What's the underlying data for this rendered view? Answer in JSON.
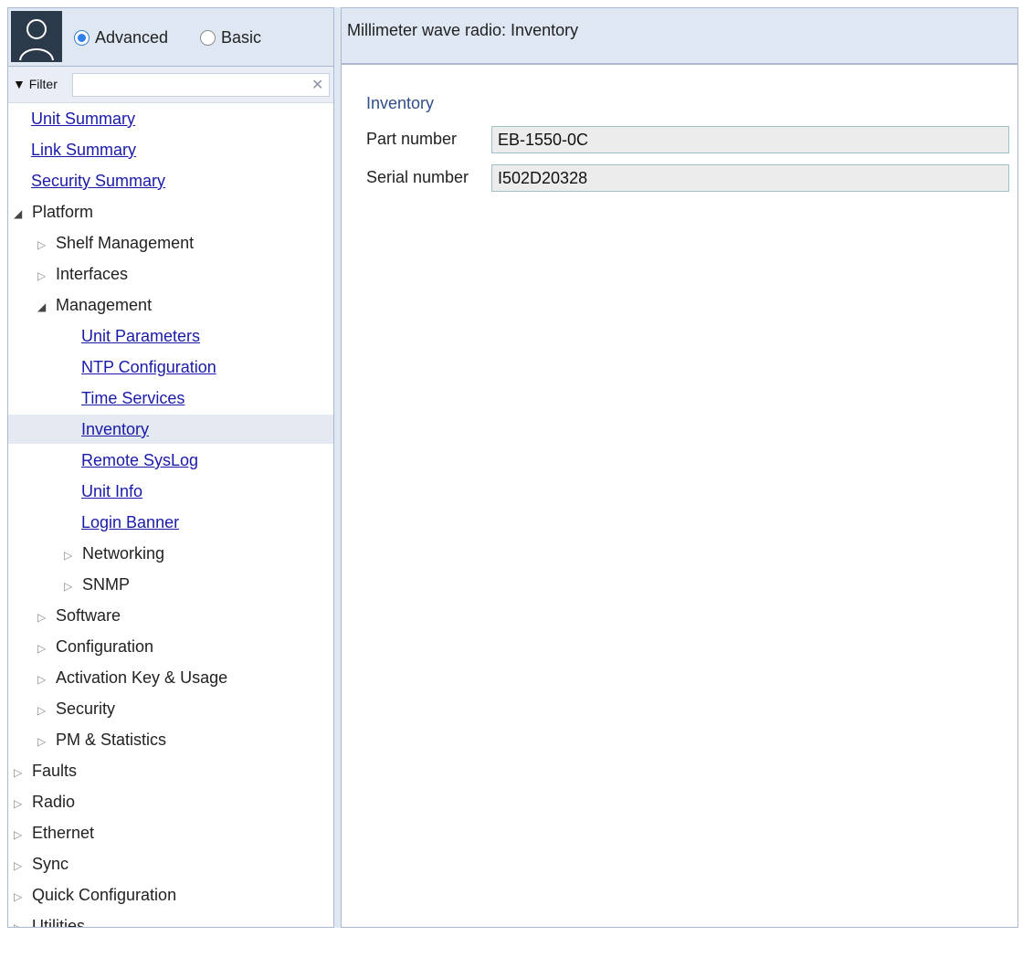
{
  "mode": {
    "advanced_label": "Advanced",
    "basic_label": "Basic",
    "selected": "Advanced"
  },
  "filter": {
    "label": "Filter",
    "value": "",
    "clear_icon": "close-icon"
  },
  "tree": {
    "unit_summary": "Unit Summary",
    "link_summary": "Link Summary",
    "security_summary": "Security Summary",
    "platform": "Platform",
    "shelf_management": "Shelf Management",
    "interfaces": "Interfaces",
    "management": "Management",
    "unit_parameters": "Unit Parameters",
    "ntp_configuration": "NTP Configuration",
    "time_services": "Time Services",
    "inventory": "Inventory",
    "remote_syslog": "Remote SysLog",
    "unit_info": "Unit Info",
    "login_banner": "Login Banner",
    "networking": "Networking",
    "snmp": "SNMP",
    "software": "Software",
    "configuration": "Configuration",
    "activation_key": "Activation Key & Usage",
    "security": "Security",
    "pm_statistics": "PM & Statistics",
    "faults": "Faults",
    "radio": "Radio",
    "ethernet": "Ethernet",
    "sync": "Sync",
    "quick_configuration": "Quick Configuration",
    "utilities": "Utilities"
  },
  "main": {
    "title": "Millimeter wave radio: Inventory",
    "section": "Inventory",
    "part_number_label": "Part number",
    "part_number_value": "EB-1550-0C",
    "serial_number_label": "Serial number",
    "serial_number_value": "I502D20328"
  },
  "colors": {
    "header_bg": "#dfe7f3",
    "link": "#1a1aa8",
    "selected_row": "#e4e9f2",
    "accent": "#2f80ed"
  }
}
